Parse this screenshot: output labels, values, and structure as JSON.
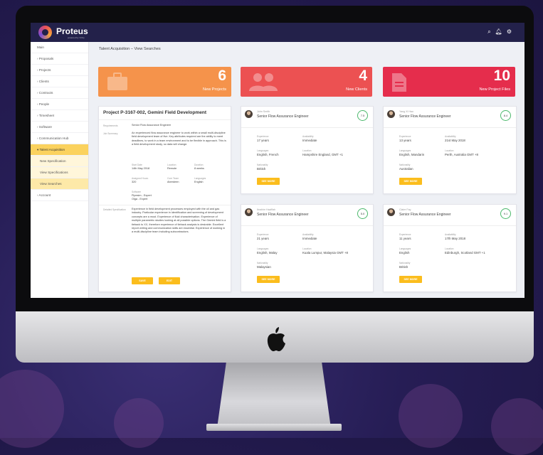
{
  "app": {
    "name": "Proteus",
    "tagline": "powered by VClip"
  },
  "topbar": {
    "icons": [
      "search-icon",
      "bell-icon",
      "gear-icon"
    ]
  },
  "sidebar": {
    "items": [
      {
        "label": "Main"
      },
      {
        "label": "› Proposals"
      },
      {
        "label": "› Projects"
      },
      {
        "label": "› Clients"
      },
      {
        "label": "› Contracts"
      },
      {
        "label": "› People"
      },
      {
        "label": "› Timesheet"
      },
      {
        "label": "› Software"
      },
      {
        "label": "› Communication Hub"
      },
      {
        "label": "▾ Talent Acquisition"
      },
      {
        "label": "New Specification"
      },
      {
        "label": "View Specifications"
      },
      {
        "label": "View Searches"
      },
      {
        "label": "› Account"
      }
    ]
  },
  "breadcrumb": "Talent Acquisition – View Searches",
  "stats": [
    {
      "value": "6",
      "label": "New Projects",
      "color": "#f5934b",
      "icon": "briefcase-icon"
    },
    {
      "value": "4",
      "label": "New Clients",
      "color": "#ec5152",
      "icon": "users-icon"
    },
    {
      "value": "10",
      "label": "New Project Files",
      "color": "#e52d4c",
      "icon": "file-icon"
    }
  ],
  "project": {
    "title": "Project P-3167-002, Gemini Field Development",
    "requirements_label": "Requirements",
    "requirements": "Senior Flow Assurance Engineer",
    "job_summary_label": "Job Summary",
    "job_summary": "An experienced flow assurance engineer to work within a small multi-discipline field development team of five. Key attributes required are the ability to meet deadlines, to work in a team environment and to be flexible in approach. This is a field development study, so data will change.",
    "start_date_label": "Start Date",
    "start_date": "14th May 2018",
    "location_label": "Location",
    "location": "Remote",
    "duration_label": "Duration",
    "duration": "8 weeks",
    "assigned_hours_label": "Assigned Hours",
    "assigned_hours": "320",
    "core_team_label": "Core Team",
    "core_team": "Aberdeen",
    "languages_label": "Languages",
    "languages": "English",
    "software_label": "Software",
    "software": "Pipesim - Expert",
    "software2": "Olga - Expert",
    "detailed_label": "Detailed Specification",
    "detailed": "Experience in field development processes employed with the oil and gas industry. Particular experience in identification and screening of development concepts are a must. Experience of fluid characterisation. Experience of multiple parametric studies looking at all possible options. The Gemini field is a tieback to XX, therefore experience of tieback analysis is desirable. Excellent report writing and communication skills are essential. Experience of working in a multi-discipline team including subcontractors.",
    "save_label": "SAVE",
    "edit_label": "EDIT"
  },
  "labels": {
    "experience": "Experience",
    "availability": "Availability",
    "languages": "Languages",
    "location": "Location",
    "nationality": "Nationality",
    "see_more": "SEE MORE"
  },
  "candidates": [
    {
      "name": "John Smith",
      "role": "Senior Flow Assurance Engineer",
      "score": "7.5",
      "experience": "17 years",
      "availability": "Immediate",
      "languages": "English, French",
      "location": "Hampshire England, GMT +1",
      "nationality": "British"
    },
    {
      "name": "Yang Xi Hao",
      "role": "Senior Flow Assurance Engineer",
      "score": "8.4",
      "experience": "13 years",
      "availability": "21st May 2018",
      "languages": "English, Mandarin",
      "location": "Perth, Australia GMT +8",
      "nationality": "Australian"
    },
    {
      "name": "Ibrahim Haziffah",
      "role": "Senior Flow Assurance Engineer",
      "score": "5.0",
      "experience": "21 years",
      "availability": "Immediate",
      "languages": "English, Malay",
      "location": "Kuala Lumpur, Malaysia GMT +8",
      "nationality": "Malaysian"
    },
    {
      "name": "Claire Fay",
      "role": "Senior Flow Assurance Engineer",
      "score": "9.1",
      "experience": "11 years",
      "availability": "17th May 2018",
      "languages": "English",
      "location": "Edinburgh, Scotland GMT +1",
      "nationality": "British"
    }
  ]
}
